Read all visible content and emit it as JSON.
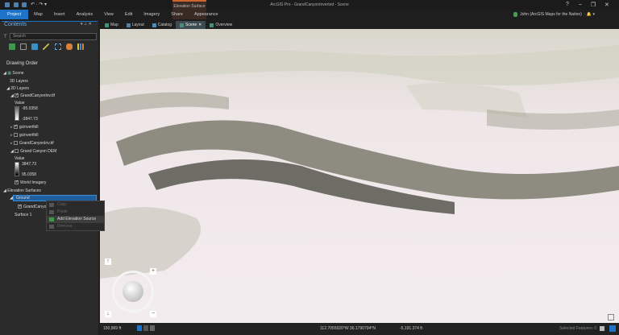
{
  "app": {
    "title": "ArcGIS Pro - GrandCanyonInverted - Scene",
    "context_tab": "Elevation Surface",
    "help": "?",
    "minimize": "–",
    "restore": "❐",
    "close": "✕"
  },
  "ribbon": {
    "tabs": [
      "Project",
      "Map",
      "Insert",
      "Analysis",
      "View",
      "Edit",
      "Imagery",
      "Share",
      "Appearance"
    ],
    "active": "Project"
  },
  "user": {
    "name": "John (ArcGIS Maps for the Nation)"
  },
  "contents": {
    "title": "Contents",
    "search_placeholder": "Search",
    "drawing_order": "Drawing Order",
    "tree": [
      {
        "label": "Scene",
        "level": 0
      },
      {
        "label": "3D Layers",
        "level": 1
      },
      {
        "label": "2D Layers",
        "level": 1
      },
      {
        "label": "GrandCanyonInv.tif",
        "level": 2,
        "checked": true
      },
      {
        "label": "Value",
        "level": 3
      },
      {
        "label": "-95.0358",
        "level": 4
      },
      {
        "label": "-3847.73",
        "level": 4
      },
      {
        "label": "gcinverthill",
        "level": 2,
        "checked": true
      },
      {
        "label": "gcinverthill",
        "level": 2,
        "checked": false
      },
      {
        "label": "GrandCanyonInv.tif",
        "level": 2,
        "checked": false
      },
      {
        "label": "Grand Canyon DEM",
        "level": 2,
        "checked": false
      },
      {
        "label": "Value",
        "level": 3
      },
      {
        "label": "3847.73",
        "level": 4
      },
      {
        "label": "95.0358",
        "level": 4
      },
      {
        "label": "World Imagery",
        "level": 2,
        "checked": true
      },
      {
        "label": "Elevation Surfaces",
        "level": 1
      },
      {
        "label": "Ground",
        "level": 2,
        "selected": true
      },
      {
        "label": "GrandCanyonInv.tif",
        "level": 3,
        "checked": true
      },
      {
        "label": "Surface 1",
        "level": 2
      }
    ]
  },
  "context_menu": [
    {
      "label": "Copy",
      "enabled": false
    },
    {
      "label": "Paste",
      "enabled": false
    },
    {
      "label": "Add Elevation Source",
      "enabled": true
    },
    {
      "label": "Remove",
      "enabled": false
    }
  ],
  "view_tabs": [
    {
      "label": "Map"
    },
    {
      "label": "Layout"
    },
    {
      "label": "Catalog"
    },
    {
      "label": "Scene",
      "active": true
    },
    {
      "label": "Overview"
    }
  ],
  "status": {
    "scale": "150,969 ft",
    "coords": "112.7055920°W 36.1790794°N",
    "elevation": "-5,191.374 ft",
    "selected": "Selected Features: 0"
  },
  "colors": {
    "accent": "#1e73c8",
    "context": "#d0642f"
  }
}
